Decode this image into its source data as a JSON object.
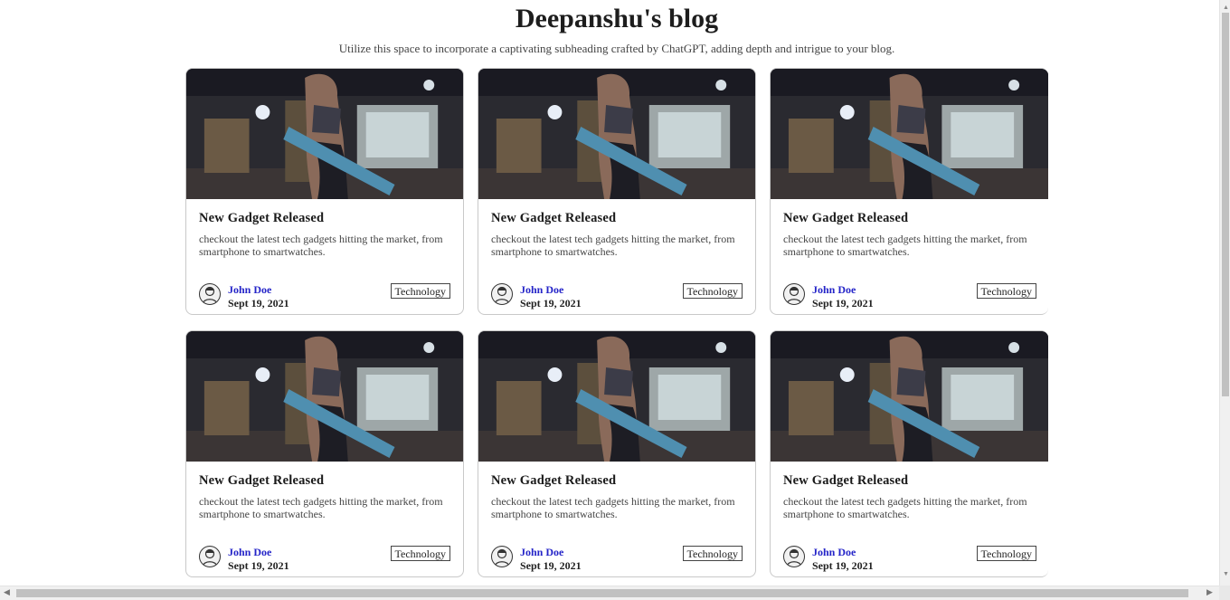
{
  "header": {
    "title": "Deepanshu's blog",
    "subtitle": "Utilize this space to incorporate a captivating subheading crafted by ChatGPT, adding depth and intrigue to your blog."
  },
  "posts": [
    {
      "title": "New Gadget Released",
      "description": "checkout the latest tech gadgets hitting the market, from smartphone to smartwatches.",
      "author": "John Doe",
      "date": "Sept 19, 2021",
      "tag": "Technology"
    },
    {
      "title": "New Gadget Released",
      "description": "checkout the latest tech gadgets hitting the market, from smartphone to smartwatches.",
      "author": "John Doe",
      "date": "Sept 19, 2021",
      "tag": "Technology"
    },
    {
      "title": "New Gadget Released",
      "description": "checkout the latest tech gadgets hitting the market, from smartphone to smartwatches.",
      "author": "John Doe",
      "date": "Sept 19, 2021",
      "tag": "Technology"
    },
    {
      "title": "New Gadget Released",
      "description": "checkout the latest tech gadgets hitting the market, from smartphone to smartwatches.",
      "author": "John Doe",
      "date": "Sept 19, 2021",
      "tag": "Technology"
    },
    {
      "title": "New Gadget Released",
      "description": "checkout the latest tech gadgets hitting the market, from smartphone to smartwatches.",
      "author": "John Doe",
      "date": "Sept 19, 2021",
      "tag": "Technology"
    },
    {
      "title": "New Gadget Released",
      "description": "checkout the latest tech gadgets hitting the market, from smartphone to smartwatches.",
      "author": "John Doe",
      "date": "Sept 19, 2021",
      "tag": "Technology"
    }
  ],
  "colors": {
    "author_link": "#2424c8",
    "card_border": "#c9c9c9"
  },
  "icons": {
    "thumbnail": "gym-photo-image",
    "avatar": "user-avatar-icon",
    "scroll_up": "arrow-up-icon",
    "scroll_down": "arrow-down-icon",
    "scroll_left": "arrow-left-icon",
    "scroll_right": "arrow-right-icon"
  }
}
